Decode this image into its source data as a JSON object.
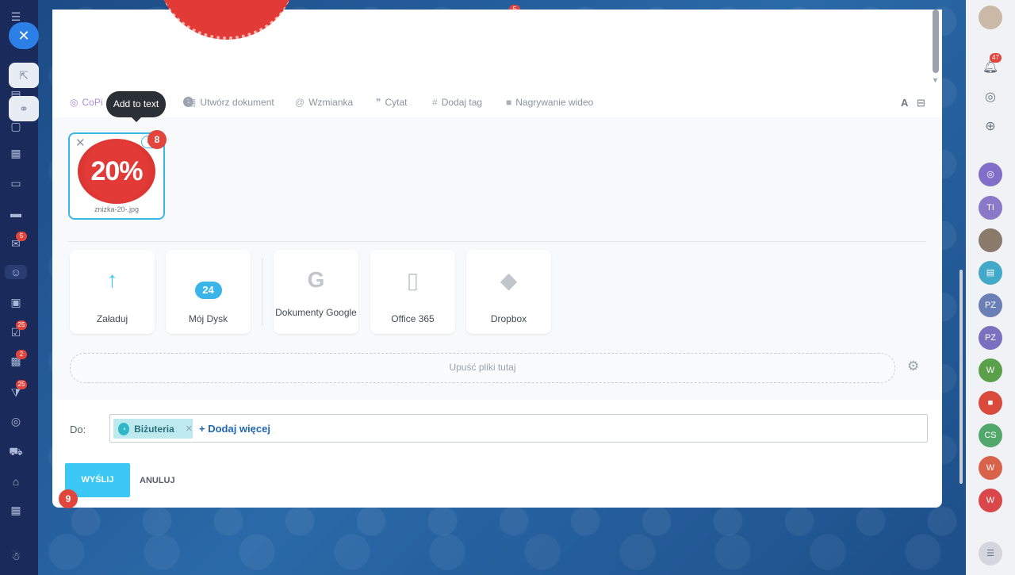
{
  "app": {
    "left_bar_badges": [
      "5",
      "25",
      "2",
      "25"
    ],
    "right_bar": {
      "notif_badge": "47",
      "avatars": [
        "TI",
        "PZ",
        "PZ",
        "W",
        "CS",
        "W",
        "W"
      ],
      "avatar_colors": [
        "#7f6fc8",
        "#8a78c9",
        "#6a7fb5",
        "#5aa04a",
        "#d94a3d",
        "#52a86b",
        "#d9634a",
        "#d9474a"
      ]
    },
    "top_badge": "5"
  },
  "toolbar": {
    "copilot_label": "CoPi",
    "icon_badge": "1",
    "create_doc": "Utwórz dokument",
    "mention": "Wzmianka",
    "quote": "Cytat",
    "add_tag": "Dodaj tag",
    "video": "Nagrywanie wideo",
    "font_icon": "A"
  },
  "tooltip": {
    "text": "Add to text"
  },
  "file": {
    "thumb_text": "20%",
    "name": "znizka-20-.jpg",
    "add_text_icon": "+T",
    "step_badge": "8"
  },
  "sources": [
    {
      "label": "Załaduj",
      "icon": "↑"
    },
    {
      "label": "Mój Dysk",
      "icon": "24"
    },
    {
      "label": "Dokumenty Google",
      "icon": "G"
    },
    {
      "label": "Office 365",
      "icon": "▯"
    },
    {
      "label": "Dropbox",
      "icon": "◆"
    }
  ],
  "drop_zone": {
    "text": "Upuść pliki tutaj"
  },
  "recipients": {
    "label": "Do:",
    "tag_label": "Biżuteria",
    "add_more": "+ Dodaj więcej"
  },
  "actions": {
    "send": "WYŚLIJ",
    "cancel": "ANULUJ",
    "step_badge": "9"
  },
  "colors": {
    "accent": "#3bc8f5",
    "badge": "#e2453c",
    "sale_red": "#e23a36"
  }
}
